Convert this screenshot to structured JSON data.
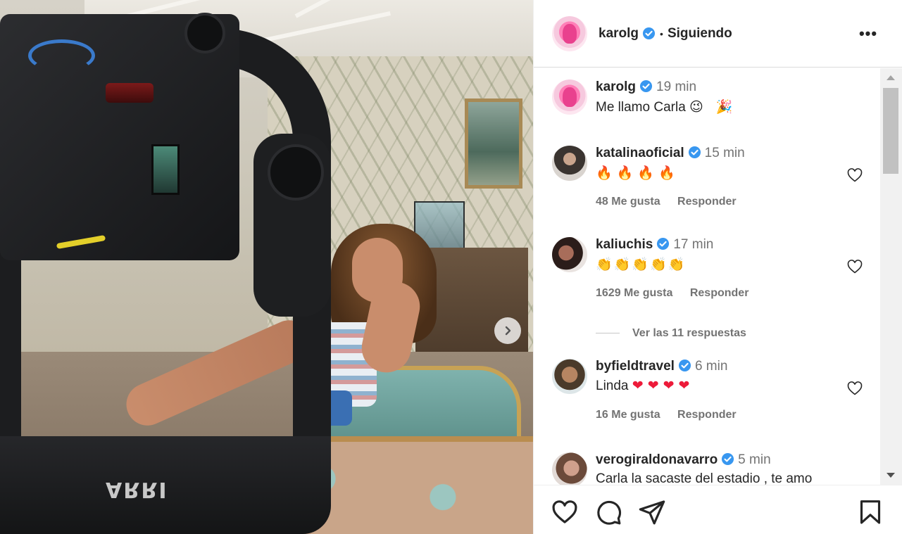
{
  "post": {
    "author": "karolg",
    "separator": "•",
    "follow_status": "Siguiendo",
    "more_label": "•••"
  },
  "comments": [
    {
      "user": "karolg",
      "time": "19 min",
      "text": "Me llamo Carla",
      "emoji": "😉 🎉",
      "likes": "",
      "reply": ""
    },
    {
      "user": "katalinaoficial",
      "time": "15 min",
      "text": "",
      "emoji": "🔥🔥🔥🔥",
      "likes": "48 Me gusta",
      "reply": "Responder"
    },
    {
      "user": "kaliuchis",
      "time": "17 min",
      "text": "",
      "emoji": "👏👏👏👏👏",
      "likes": "1629 Me gusta",
      "reply": "Responder"
    },
    {
      "user": "byfieldtravel",
      "time": "6 min",
      "text": "Linda",
      "emoji": "❤❤❤❤",
      "likes": "16 Me gusta",
      "reply": "Responder"
    },
    {
      "user": "verogiraldonavarro",
      "time": "5 min",
      "text": "Carla la sacaste del estadio , te amo",
      "emoji": "",
      "likes": "",
      "reply": ""
    }
  ],
  "view_replies": "Ver las 11 respuestas",
  "photo": {
    "rig_logo": "ARRI"
  },
  "colors": {
    "verified": "#3897f0",
    "text": "#262626",
    "muted": "#737373",
    "heart_red": "#ed1b3a"
  },
  "icons": [
    "heart-icon",
    "comment-icon",
    "share-icon",
    "bookmark-icon",
    "chevron-right-icon",
    "verified-badge-icon"
  ]
}
